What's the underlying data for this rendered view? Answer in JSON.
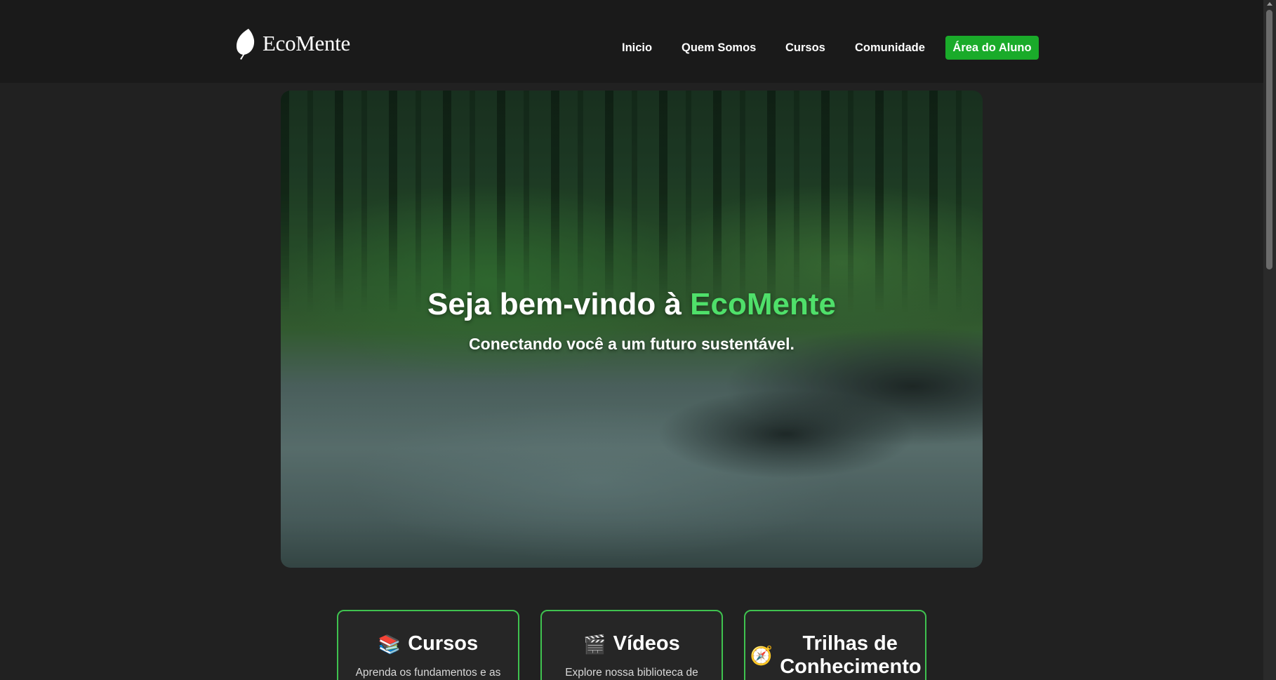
{
  "header": {
    "logo_text": "EcoMente",
    "nav": [
      {
        "label": "Inicio"
      },
      {
        "label": "Quem Somos"
      },
      {
        "label": "Cursos"
      },
      {
        "label": "Comunidade"
      }
    ],
    "cta_label": "Área do Aluno"
  },
  "hero": {
    "title_prefix": "Seja bem-vindo à ",
    "title_accent": "EcoMente",
    "subtitle": "Conectando você a um futuro sustentável.",
    "accent_color": "#4fe06a"
  },
  "cards": [
    {
      "icon": "📚",
      "icon_name": "books-icon",
      "title": "Cursos",
      "desc": "Aprenda os fundamentos e as"
    },
    {
      "icon": "🎬",
      "icon_name": "clapperboard-icon",
      "title": "Vídeos",
      "desc": "Explore nossa biblioteca de"
    },
    {
      "icon": "🧭",
      "icon_name": "compass-icon",
      "title": "Trilhas de Conhecimento",
      "desc": ""
    }
  ],
  "colors": {
    "background": "#212121",
    "header": "#1a1a1a",
    "brand_green": "#1aab2a",
    "card_border": "#3fc24f"
  }
}
